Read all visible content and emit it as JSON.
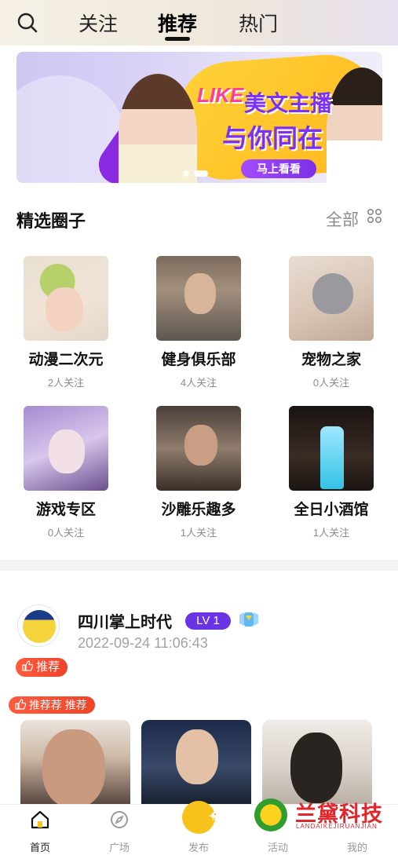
{
  "top_nav": {
    "tabs": [
      {
        "label": "关注"
      },
      {
        "label": "推荐"
      },
      {
        "label": "热门"
      }
    ],
    "active_tab": "推荐"
  },
  "banner": {
    "title_line1_a": "LIKE",
    "title_line1_b": "美文主播",
    "title_line2": "与你同在",
    "cta": "马上看看",
    "pages": 2,
    "active_page": 1
  },
  "circles_section": {
    "title": "精选圈子",
    "all_label": "全部",
    "items": [
      {
        "name": "动漫二次元",
        "followers": "2人关注"
      },
      {
        "name": "健身俱乐部",
        "followers": "4人关注"
      },
      {
        "name": "宠物之家",
        "followers": "0人关注"
      },
      {
        "name": "游戏专区",
        "followers": "0人关注"
      },
      {
        "name": "沙雕乐趣多",
        "followers": "1人关注"
      },
      {
        "name": "全日小酒馆",
        "followers": "1人关注"
      }
    ]
  },
  "post": {
    "username": "四川掌上时代",
    "level": "LV 1",
    "time": "2022-09-24 11:06:43",
    "recommend_tag": "推荐",
    "topic_tag": "推荐荐 推荐"
  },
  "tabbar": {
    "items": [
      {
        "label": "首页"
      },
      {
        "label": "广场"
      },
      {
        "label": "发布"
      },
      {
        "label": "活动"
      },
      {
        "label": "我的"
      }
    ],
    "active": "首页"
  },
  "watermark": {
    "name": "兰黛科技",
    "sub": "LANDAIKEJIRUANJIAN"
  },
  "colors": {
    "accent_purple": "#6b33e6",
    "tag_red": "#f0442a",
    "publish_yellow": "#f7c21b"
  }
}
